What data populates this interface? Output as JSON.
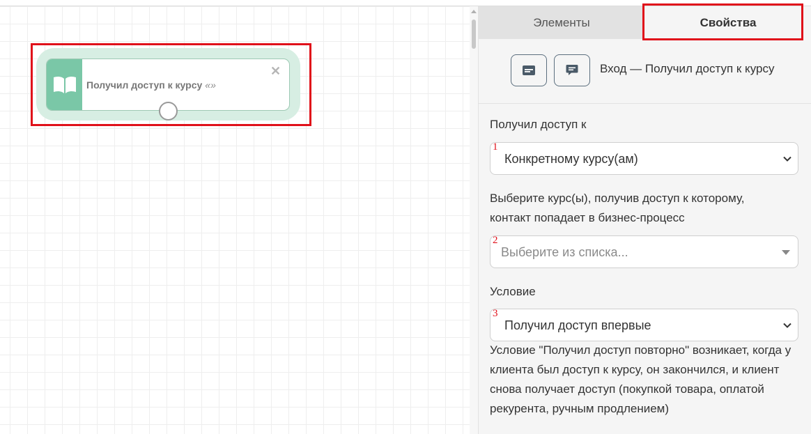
{
  "canvas": {
    "node": {
      "title": "Получил доступ к курсу",
      "suffix": "«»",
      "icon": "book-icon",
      "close_icon": "close-icon"
    }
  },
  "panel": {
    "tabs": [
      {
        "label": "Элементы",
        "active": false
      },
      {
        "label": "Свойства",
        "active": true
      }
    ],
    "header": {
      "buttons": [
        "card-icon",
        "comment-icon"
      ],
      "text": "Вход — Получил доступ к курсу"
    },
    "fields": {
      "access": {
        "label": "Получил доступ к",
        "marker": "1",
        "value": "Конкретному курсу(ам)"
      },
      "courses": {
        "label_line1": "Выберите курс(ы), получив доступ к которому,",
        "label_line2": "контакт попадает в бизнес-процесс",
        "marker": "2",
        "placeholder": "Выберите из списка..."
      },
      "condition": {
        "label": "Условие",
        "marker": "3",
        "value": "Получил доступ впервые",
        "note": "Условие \"Получил доступ повторно\" возникает, когда у клиента был доступ к курсу, он закончился, и клиент снова получает доступ (покупкой товара, оплатой рекурента, ручным продлением)"
      }
    }
  },
  "colors": {
    "highlight": "#e0101a",
    "node_accent": "#7ac7a7",
    "node_bg": "#d7eee3"
  }
}
